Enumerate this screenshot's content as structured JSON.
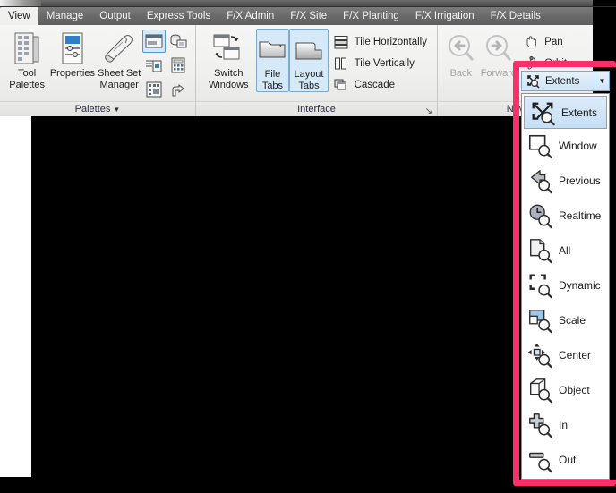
{
  "window": {
    "title_strip": ""
  },
  "ribbon_tabs": [
    {
      "label": "View",
      "active": true
    },
    {
      "label": "Manage",
      "active": false
    },
    {
      "label": "Output",
      "active": false
    },
    {
      "label": "Express Tools",
      "active": false
    },
    {
      "label": "F/X Admin",
      "active": false
    },
    {
      "label": "F/X Site",
      "active": false
    },
    {
      "label": "F/X Planting",
      "active": false
    },
    {
      "label": "F/X Irrigation",
      "active": false
    },
    {
      "label": "F/X Details",
      "active": false
    }
  ],
  "panels": {
    "palettes": {
      "title": "Palettes",
      "has_caret": true,
      "buttons": [
        {
          "label": "Tool\nPalettes",
          "icon": "tool-palettes-icon"
        },
        {
          "label": "Properties",
          "icon": "properties-icon"
        },
        {
          "label": "Sheet Set\nManager",
          "icon": "sheet-set-manager-icon"
        }
      ],
      "small_icons": [
        {
          "icon": "external-references-icon",
          "selected": true
        },
        {
          "icon": "dbconnect-icon",
          "selected": false
        },
        {
          "icon": "markup-set-manager-icon",
          "selected": false
        },
        {
          "icon": "quickcalc-icon",
          "selected": false
        },
        {
          "icon": "data-extraction-icon",
          "selected": false
        },
        {
          "icon": "materials-browser-icon",
          "selected": false
        }
      ]
    },
    "interface": {
      "title": "Interface",
      "has_dialog_launcher": true,
      "buttons": [
        {
          "label": "Switch\nWindows",
          "icon": "switch-windows-icon",
          "has_caret": true,
          "selected": false
        },
        {
          "label": "File\nTabs",
          "icon": "file-tabs-icon",
          "has_caret": false,
          "selected": true
        },
        {
          "label": "Layout\nTabs",
          "icon": "layout-tabs-icon",
          "has_caret": false,
          "selected": true
        }
      ],
      "rows": [
        {
          "label": "Tile Horizontally",
          "icon": "tile-horizontally-icon"
        },
        {
          "label": "Tile Vertically",
          "icon": "tile-vertically-icon"
        },
        {
          "label": "Cascade",
          "icon": "cascade-icon"
        }
      ]
    },
    "navigate": {
      "title": "Nav",
      "buttons": [
        {
          "label": "Back",
          "icon": "zoom-back-icon",
          "dimmed": true
        },
        {
          "label": "Forward",
          "icon": "zoom-forward-icon",
          "dimmed": true
        }
      ],
      "rows": [
        {
          "label": "Pan",
          "icon": "pan-hand-icon",
          "has_caret": false
        },
        {
          "label": "Orbit",
          "icon": "orbit-icon",
          "has_caret": true
        }
      ]
    }
  },
  "zoom_split_button": {
    "label": "Extents",
    "icon": "zoom-extents-icon",
    "dropdown_arrow": "▼"
  },
  "zoom_menu": {
    "items": [
      {
        "label": "Extents",
        "icon": "zoom-extents-icon",
        "selected": true
      },
      {
        "label": "Window",
        "icon": "zoom-window-icon",
        "selected": false
      },
      {
        "label": "Previous",
        "icon": "zoom-previous-icon",
        "selected": false
      },
      {
        "label": "Realtime",
        "icon": "zoom-realtime-icon",
        "selected": false
      },
      {
        "label": "All",
        "icon": "zoom-all-icon",
        "selected": false
      },
      {
        "label": "Dynamic",
        "icon": "zoom-dynamic-icon",
        "selected": false
      },
      {
        "label": "Scale",
        "icon": "zoom-scale-icon",
        "selected": false
      },
      {
        "label": "Center",
        "icon": "zoom-center-icon",
        "selected": false
      },
      {
        "label": "Object",
        "icon": "zoom-object-icon",
        "selected": false
      },
      {
        "label": "In",
        "icon": "zoom-in-icon",
        "selected": false
      },
      {
        "label": "Out",
        "icon": "zoom-out-icon",
        "selected": false
      }
    ]
  },
  "highlight": {
    "color": "#ff2e6a",
    "target": "zoom-dropdown-menu"
  },
  "canvas": {
    "background_color": "#000000"
  }
}
